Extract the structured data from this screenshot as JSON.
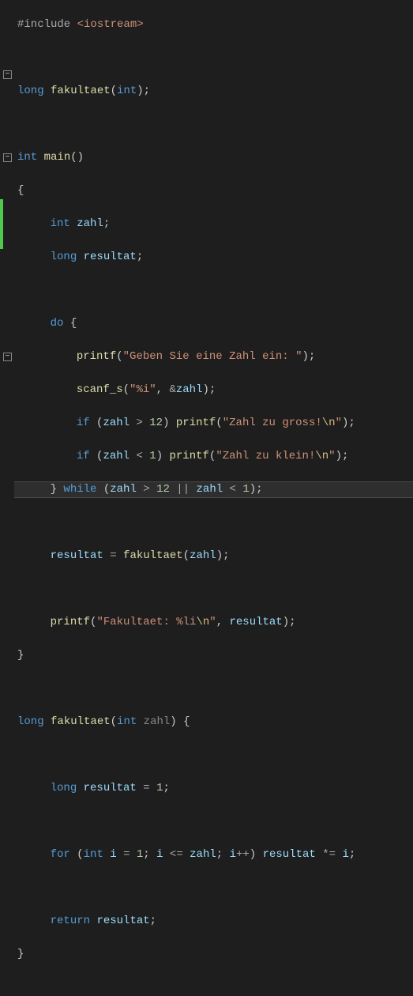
{
  "code": {
    "l1_include": "#include",
    "l1_hdr": "<iostream>",
    "l3_long": "long",
    "l3_fn": "fakultaet",
    "l3_int": "int",
    "l5_int": "int",
    "l5_main": "main",
    "l7_int": "int",
    "l7_zahl": "zahl",
    "l8_long": "long",
    "l8_resultat": "resultat",
    "l10_do": "do",
    "l11_printf": "printf",
    "l11_str": "\"Geben Sie eine Zahl ein: \"",
    "l12_scanf": "scanf_s",
    "l12_str": "\"%i\"",
    "l12_zahl": "zahl",
    "l13_if": "if",
    "l13a_zahl": "zahl",
    "l13_num": "12",
    "l13_printf": "printf",
    "l13_str1": "\"Zahl zu gross!",
    "l13_esc": "\\n",
    "l13_str2": "\"",
    "l14_if": "if",
    "l14a_zahl": "zahl",
    "l14_num": "1",
    "l14_printf": "printf",
    "l14_str1": "\"Zahl zu klein!",
    "l14_esc": "\\n",
    "l14_str2": "\"",
    "l15_while": "while",
    "l15a_zahl": "zahl",
    "l15_12": "12",
    "l15b_zahl": "zahl",
    "l15_1": "1",
    "l17_resultat": "resultat",
    "l17_fn": "fakultaet",
    "l17_zahl": "zahl",
    "l19_printf": "printf",
    "l19_str1": "\"Fakultaet: %li",
    "l19_esc": "\\n",
    "l19_str2": "\"",
    "l19_resultat": "resultat",
    "l22_long": "long",
    "l22_fn": "fakultaet",
    "l22_int": "int",
    "l22_zahl": "zahl",
    "l24_long": "long",
    "l24_resultat": "resultat",
    "l24_1": "1",
    "l26_for": "for",
    "l26_int": "int",
    "l26_i1": "i",
    "l26_1": "1",
    "l26_i2": "i",
    "l26_zahl": "zahl",
    "l26_i3": "i",
    "l26_resultat": "resultat",
    "l26_i4": "i",
    "l28_return": "return",
    "l28_resultat": "resultat"
  },
  "fold_markers": [
    {
      "line": 5,
      "symbol": "−"
    },
    {
      "line": 10,
      "symbol": "−"
    },
    {
      "line": 22,
      "symbol": "−"
    }
  ],
  "change_bar_lines": [
    13,
    14,
    15
  ],
  "highlight_line": 15
}
